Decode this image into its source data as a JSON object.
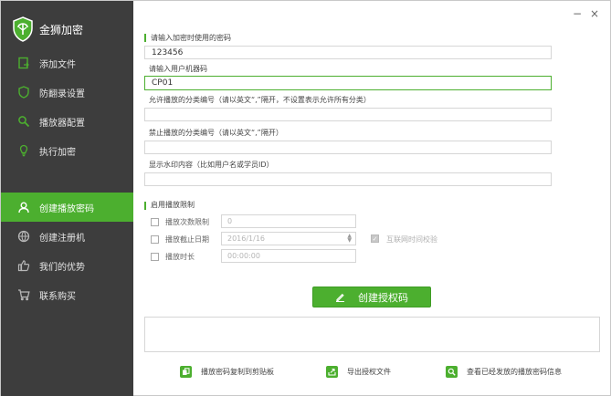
{
  "app": {
    "title": "金狮加密"
  },
  "window": {
    "minimize_glyph": "−",
    "close_glyph": "×"
  },
  "sidebar": {
    "items_top": [
      {
        "label": "添加文件",
        "icon": "file-icon"
      },
      {
        "label": "防翻录设置",
        "icon": "shield-icon"
      },
      {
        "label": "播放器配置",
        "icon": "search-icon"
      },
      {
        "label": "执行加密",
        "icon": "lightbulb-icon"
      }
    ],
    "items_bottom": [
      {
        "label": "创建播放密码",
        "icon": "user-icon",
        "active": true
      },
      {
        "label": "创建注册机",
        "icon": "globe-icon"
      },
      {
        "label": "我们的优势",
        "icon": "thumbs-up-icon"
      },
      {
        "label": "联系购买",
        "icon": "cart-icon"
      }
    ]
  },
  "form": {
    "password": {
      "label": "请输入加密时使用的密码",
      "value": "123456"
    },
    "machine_code": {
      "label": "请输入用户机器码",
      "value": "CP01"
    },
    "allowed_categories": {
      "label": "允许播放的分类编号（请以英文“,”隔开，不设置表示允许所有分类）",
      "value": ""
    },
    "forbidden_categories": {
      "label": "禁止播放的分类编号（请以英文“,”隔开）",
      "value": ""
    },
    "watermark": {
      "label": "显示水印内容（比如用户名或学员ID）",
      "value": ""
    }
  },
  "limits": {
    "section_label": "启用播放限制",
    "play_count": {
      "label": "播放次数限制",
      "value": "0"
    },
    "expiry_date": {
      "label": "播放截止日期",
      "value": "2016/1/16"
    },
    "play_duration": {
      "label": "播放时长",
      "value": "00:00:00"
    },
    "online_check": {
      "label": "互联网时间校验",
      "checked": true
    }
  },
  "create_button": {
    "label": "创建授权码"
  },
  "actions": [
    {
      "label": "播放密码复制到剪贴板",
      "icon": "copy-icon"
    },
    {
      "label": "导出授权文件",
      "icon": "export-icon"
    },
    {
      "label": "查看已经发放的播放密码信息",
      "icon": "search-icon"
    }
  ],
  "colors": {
    "accent": "#4caf2f",
    "sidebar_bg": "#3d3d3d"
  }
}
